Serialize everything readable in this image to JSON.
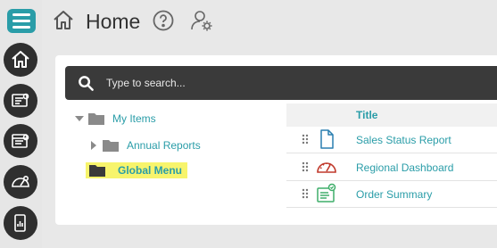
{
  "header": {
    "title": "Home",
    "icons": [
      "home-icon",
      "help-icon",
      "user-settings-icon"
    ]
  },
  "rail": {
    "items": [
      "menu-icon",
      "home-icon",
      "report-icon",
      "status-report-icon",
      "dashboard-gauge-icon",
      "mobile-report-icon"
    ]
  },
  "search": {
    "placeholder": "Type to search..."
  },
  "tree": {
    "my_items": "My Items",
    "annual_reports": "Annual Reports",
    "global_menu": "Global Menu"
  },
  "list": {
    "column_title": "Title",
    "rows": [
      {
        "label": "Sales Status Report",
        "icon": "document-icon"
      },
      {
        "label": "Regional Dashboard",
        "icon": "gauge-icon"
      },
      {
        "label": "Order Summary",
        "icon": "summary-icon"
      }
    ]
  },
  "colors": {
    "accent": "#2a9da8",
    "dark": "#2f2f2f",
    "highlight": "#f7f46c",
    "dashboard_red": "#c0392b",
    "summary_green": "#3fae6a"
  }
}
